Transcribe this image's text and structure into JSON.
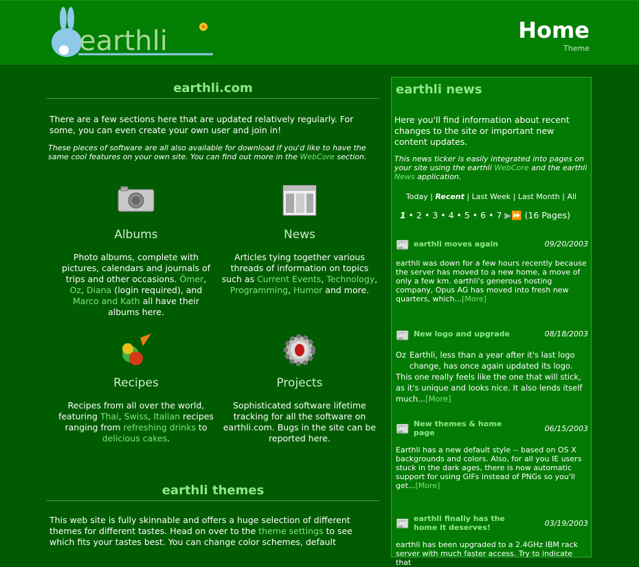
{
  "header": {
    "title": "Home",
    "theme_label": "Theme",
    "logo_text": "earthli"
  },
  "main": {
    "section_title": "earthli.com",
    "intro": "There are a few sections here that are updated relatively regularly. For some, you can even create your own user and join in!",
    "intro_italic_pre": "These pieces of software are all also available for download if you'd like to have the same cool features on your own site. You can find out more in the ",
    "intro_italic_link": "WebCore",
    "intro_italic_post": " section.",
    "albums": {
      "title": "Albums",
      "d1": "Photo albums, complete with pictures, calendars and journals of trips and other occasions. ",
      "l1": "Ömer",
      "s1": ", ",
      "l2": "Oz",
      "s2": ", ",
      "l3": "Diana",
      "d2": " (login required), and ",
      "l4": "Marco and Kath",
      "d3": " all have their albums here."
    },
    "news": {
      "title": "News",
      "d1": "Articles tying together various threads of information on topics such as ",
      "l1": "Current Events",
      "s1": ", ",
      "l2": "Technology",
      "s2": ", ",
      "l3": "Programming",
      "s3": ", ",
      "l4": "Humor",
      "d2": " and more."
    },
    "recipes": {
      "title": "Recipes",
      "d1": "Recipes from all over the world, featuring ",
      "l1": "Thai",
      "s1": ", ",
      "l2": "Swiss",
      "s2": ", ",
      "l3": "Italian",
      "d2": " recipes ranging from ",
      "l4": "refreshing drinks",
      "d3": " to ",
      "l5": "delicious cakes",
      "d4": "."
    },
    "projects": {
      "title": "Projects",
      "desc": "Sophisticated software lifetime tracking for all the software on earthli.com. Bugs in the site can be reported here."
    },
    "themes_title": "earthli themes",
    "themes_pre": "This web site is fully skinnable and offers a huge selection of different themes for different tastes. Head on over to the ",
    "themes_link": "theme settings",
    "themes_post": " to see which fits your tastes best. You can change color schemes, default"
  },
  "sidebar": {
    "title": "earthli news",
    "intro": "Here you'll find information about recent changes to the site or important new content updates.",
    "intro2_pre": "This news ticker is easily integrated into pages on your site using the earthli ",
    "intro2_link1": "WebCore",
    "intro2_mid": " and the earthli ",
    "intro2_link2": "News",
    "intro2_post": " application.",
    "filters": [
      "Today",
      "Recent",
      "Last Week",
      "Last Month",
      "All"
    ],
    "pages": [
      "1",
      "2",
      "3",
      "4",
      "5",
      "6",
      "7"
    ],
    "page_count": "(16 Pages)",
    "items": [
      {
        "title": "earthli moves again",
        "date": "09/20/2003",
        "body": "earthli was down for a few hours recently because the server has moved to a new home, a move of only a few km. earthli's generous hosting company, Opus AG has moved into fresh new quarters, which...",
        "more": "[More]"
      },
      {
        "title": "New logo and upgrade",
        "date": "08/18/2003",
        "tag": "Oz",
        "body1": "Earthli, less than a year after it's last logo change, has once again updated its logo.",
        "body2": "This one really feels like the one that will stick, as it's unique and looks nice. It also lends itself much...",
        "more": "[More]"
      },
      {
        "title": "New themes & home page",
        "date": "06/15/2003",
        "body": "Earthli has a new default style -- based on OS X backgrounds and colors. Also, for all you IE users stuck in the dark ages, there is now automatic support for using GIFs instead of PNGs so you'll get...",
        "more": "[More]"
      },
      {
        "title": "earthli finally has the home it deserves!",
        "date": "03/19/2003",
        "body": "earthli has been upgraded to a 2.4GHz IBM rack server with much faster access. Try to indicate that"
      }
    ]
  },
  "colors": {
    "bg": "#015c01",
    "header": "#037f03",
    "accent": "#8fe88a",
    "link": "#7ee57a"
  }
}
